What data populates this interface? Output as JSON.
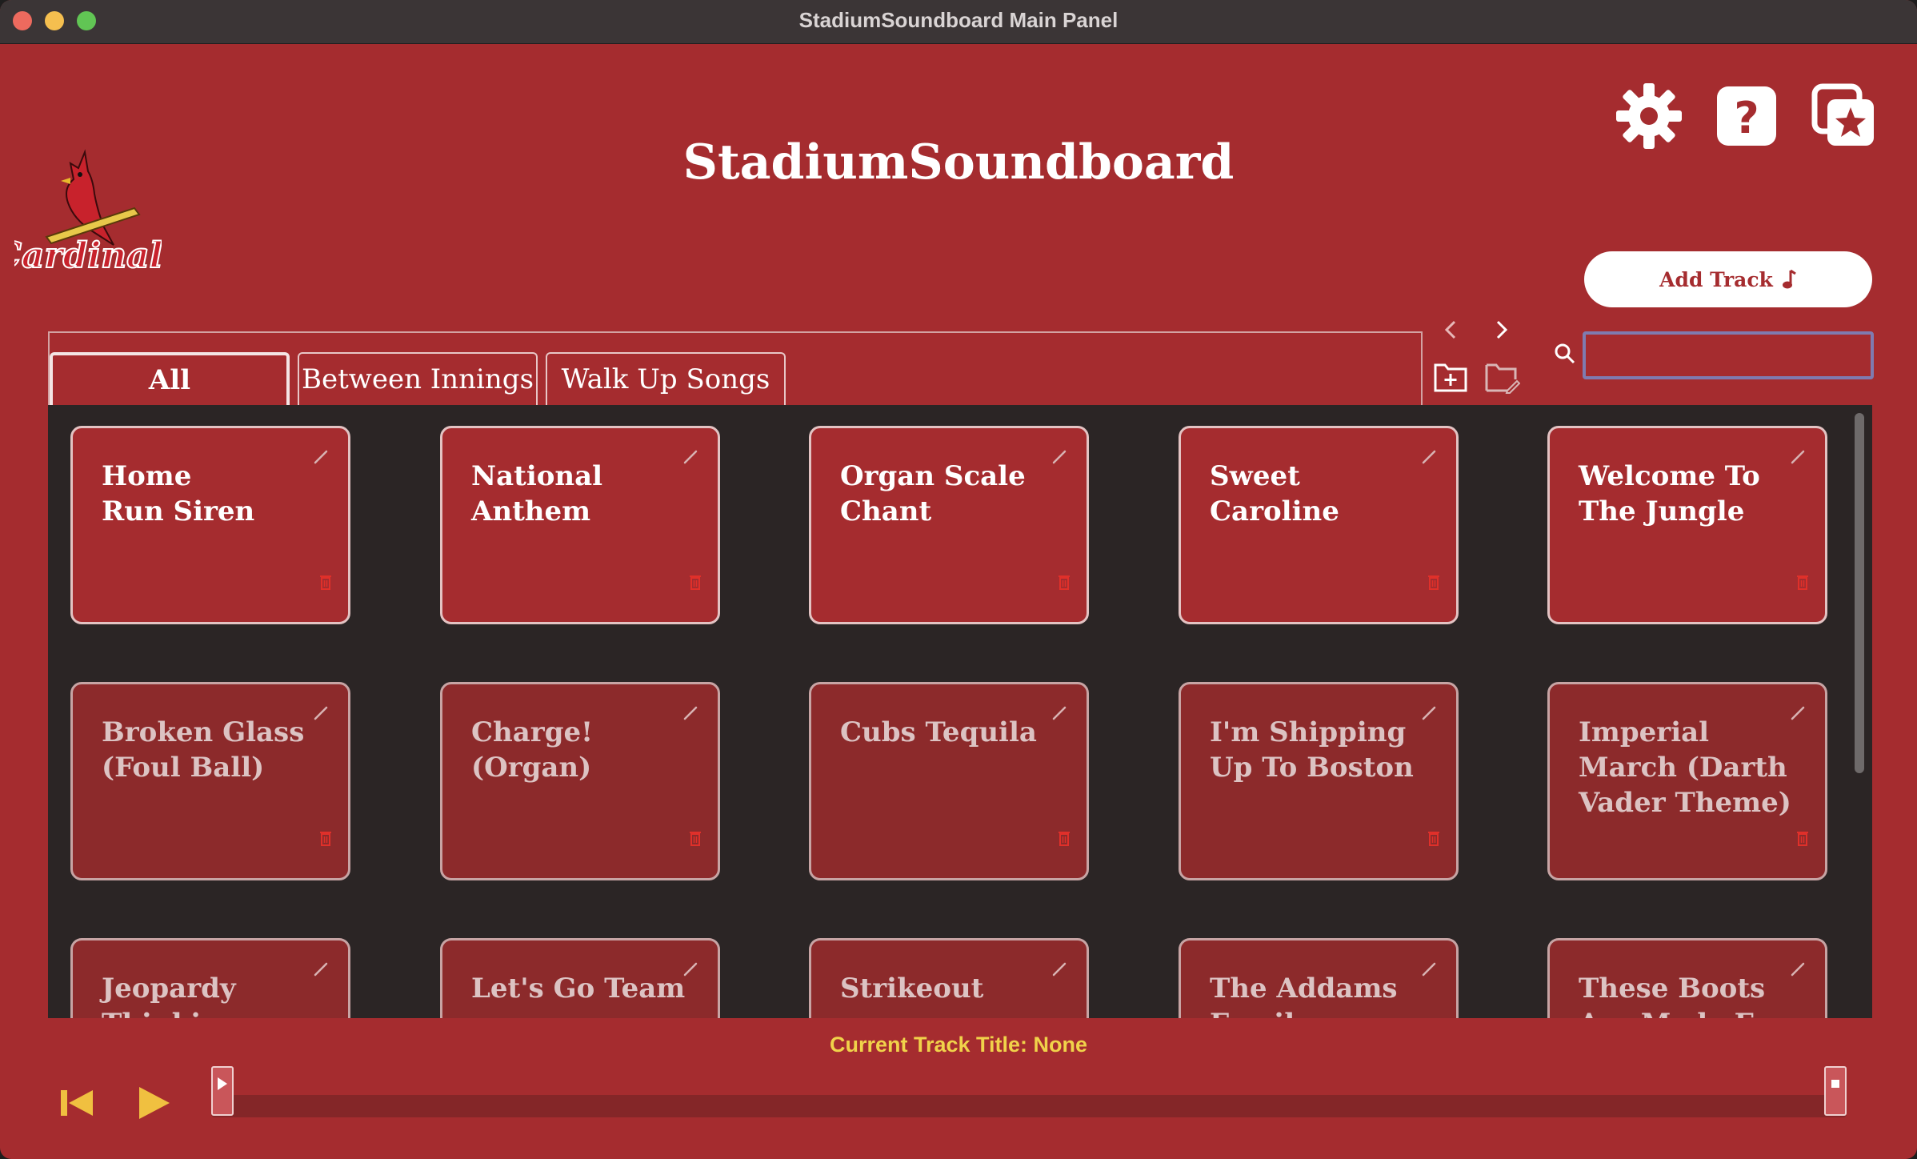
{
  "window": {
    "title": "StadiumSoundboard Main Panel"
  },
  "app": {
    "title": "StadiumSoundboard",
    "logo_text": "Cardinals"
  },
  "header_icons": [
    "gear-icon",
    "help-icon",
    "favorites-icon"
  ],
  "add_track": {
    "label": "Add Track",
    "icon": "music-note-icon"
  },
  "tabs": [
    {
      "label": "All",
      "active": true
    },
    {
      "label": "Between Innings",
      "active": false
    },
    {
      "label": "Walk Up Songs",
      "active": false
    }
  ],
  "search": {
    "value": "",
    "placeholder": ""
  },
  "tracks": [
    {
      "title": "Home\nRun Siren",
      "style": "active"
    },
    {
      "title": "National\nAnthem",
      "style": "active"
    },
    {
      "title": "Organ Scale\nChant",
      "style": "active"
    },
    {
      "title": "Sweet\nCaroline",
      "style": "active"
    },
    {
      "title": "Welcome To\nThe Jungle",
      "style": "active"
    },
    {
      "title": "Broken Glass\n(Foul Ball)",
      "style": "dim"
    },
    {
      "title": "Charge!\n(Organ)",
      "style": "dim"
    },
    {
      "title": "Cubs Tequila",
      "style": "dim"
    },
    {
      "title": "I'm Shipping\nUp To Boston",
      "style": "dim"
    },
    {
      "title": "Imperial\nMarch (Darth\nVader Theme)",
      "style": "dim"
    },
    {
      "title": "Jeopardy\nThinking",
      "style": "dim"
    },
    {
      "title": "Let's Go Team",
      "style": "dim"
    },
    {
      "title": "Strikeout",
      "style": "dim"
    },
    {
      "title": "The Addams\nFamily",
      "style": "dim"
    },
    {
      "title": "These Boots\nAre Made For",
      "style": "dim"
    }
  ],
  "player": {
    "current_track_label": "Current Track Title: None",
    "progress": 0
  },
  "colors": {
    "background": "#a52c2f",
    "grid_background": "#2b2525",
    "accent_text": "#f0d24a"
  }
}
